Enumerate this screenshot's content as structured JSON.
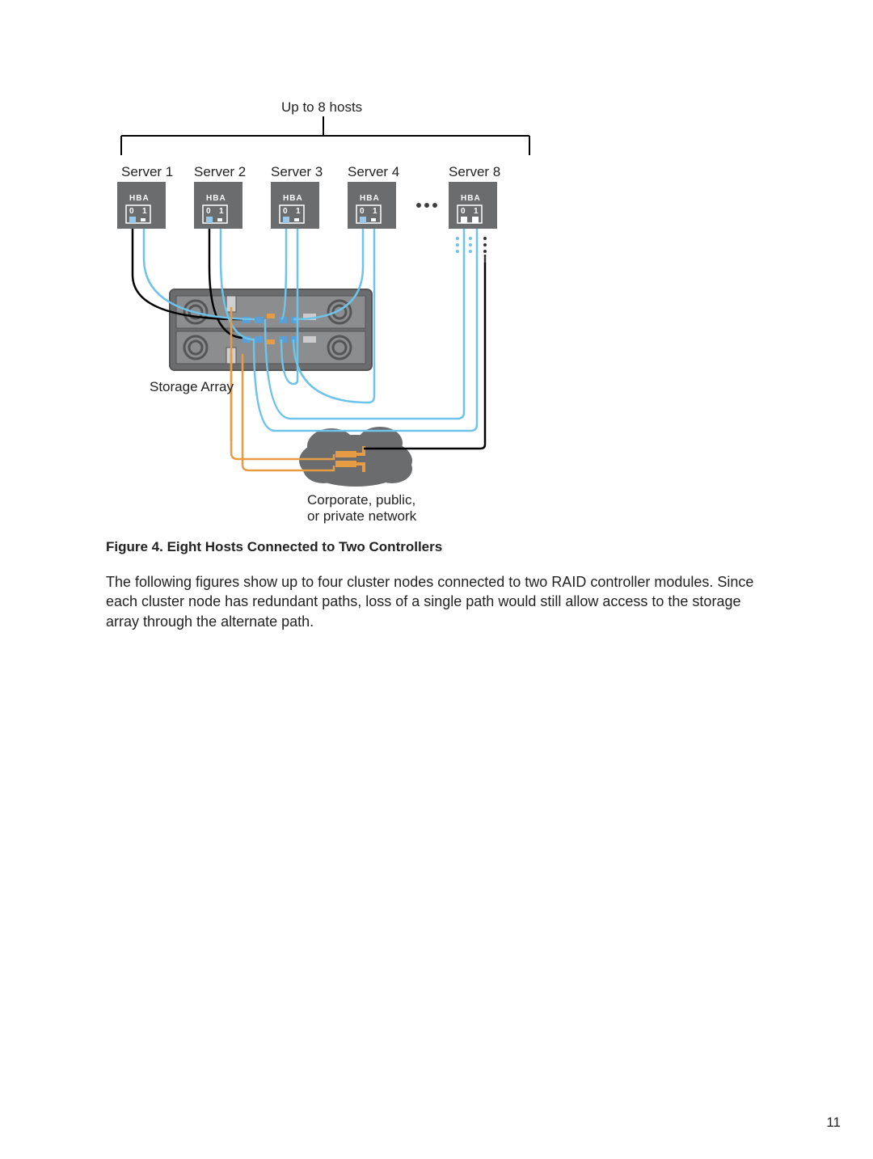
{
  "diagram": {
    "top_label": "Up to 8 hosts",
    "servers": [
      "Server 1",
      "Server 2",
      "Server 3",
      "Server 4",
      "Server 8"
    ],
    "hba_label": "HBA",
    "port0": "0",
    "port1": "1",
    "storage_label": "Storage Array",
    "network_label_l1": "Corporate, public,",
    "network_label_l2": "or private network"
  },
  "figure_caption": "Figure 4. Eight Hosts Connected to Two Controllers",
  "body_text": "The following figures show up to four cluster nodes connected to two RAID controller modules. Since each cluster node has redundant paths, loss of a single path would still allow access to the storage array through the alternate path.",
  "page_number": "11"
}
